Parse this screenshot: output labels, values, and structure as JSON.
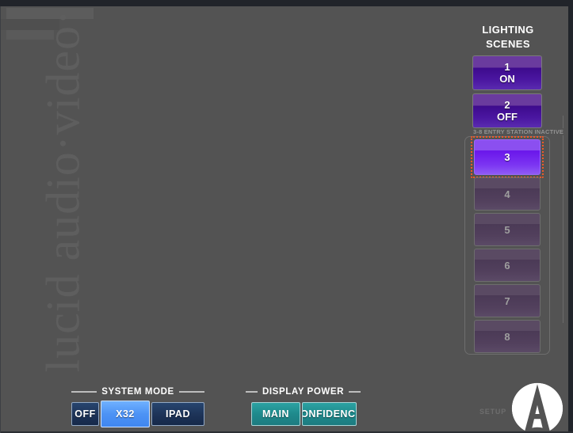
{
  "watermark": {
    "text": "lucid audio·video·"
  },
  "lighting": {
    "title_line1": "LIGHTING",
    "title_line2": "SCENES",
    "group_legend": "3-8 ENTRY STATION INACTIVE",
    "scenes": [
      {
        "number": "1",
        "state": "ON",
        "enabled": true,
        "selected": false
      },
      {
        "number": "2",
        "state": "OFF",
        "enabled": true,
        "selected": false
      },
      {
        "number": "3",
        "state": "",
        "enabled": true,
        "selected": true
      },
      {
        "number": "4",
        "state": "",
        "enabled": false,
        "selected": false
      },
      {
        "number": "5",
        "state": "",
        "enabled": false,
        "selected": false
      },
      {
        "number": "6",
        "state": "",
        "enabled": false,
        "selected": false
      },
      {
        "number": "7",
        "state": "",
        "enabled": false,
        "selected": false
      },
      {
        "number": "8",
        "state": "",
        "enabled": false,
        "selected": false
      }
    ]
  },
  "system_mode": {
    "header": "SYSTEM MODE",
    "options": [
      {
        "label": "OFF",
        "selected": false
      },
      {
        "label": "X32",
        "selected": true
      },
      {
        "label": "IPAD",
        "selected": false
      }
    ]
  },
  "display_power": {
    "header": "DISPLAY POWER",
    "options": [
      {
        "label": "MAIN",
        "selected": false
      },
      {
        "label": "CONFIDENCE",
        "selected": false
      }
    ]
  },
  "footer": {
    "setup_label": "SETUP",
    "logo_name": "lucid-a-logo"
  },
  "colors": {
    "background": "#535353",
    "window_border": "#21242a",
    "scene_purple": "#4a16a0",
    "scene_active_purple": "#7b34f2",
    "scene_disabled_purple": "#52405d",
    "focus_ring": "#f05a28",
    "mode_blue": "#1d3357",
    "mode_blue_active": "#4d93f5",
    "display_teal": "#1f8a8c",
    "text_white": "#ffffff",
    "text_dim": "#9e9e9e"
  }
}
